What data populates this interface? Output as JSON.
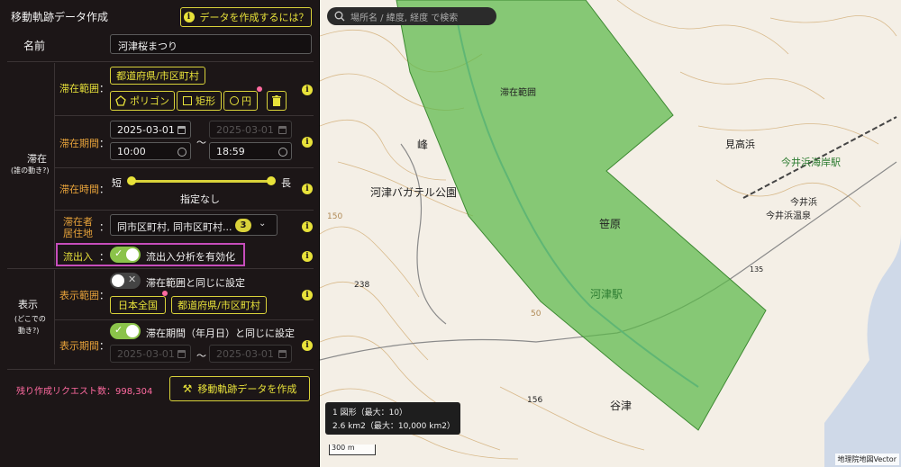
{
  "header": {
    "title": "移動軌跡データ作成",
    "help_button": "データを作成するには？"
  },
  "name_field": {
    "label": "名前",
    "value": "河津桜まつり"
  },
  "stay": {
    "section_label": "滞在",
    "section_sublabel": "(誰の動き?)",
    "range": {
      "label": "滞在範囲",
      "pref_button": "都道府県/市区町村",
      "polygon_button": "ポリゴン",
      "rect_button": "矩形",
      "circle_button": "円"
    },
    "period": {
      "label": "滞在期間",
      "start_date": "2025-03-01",
      "start_time": "10:00",
      "separator": "～",
      "end_date": "2025-03-01",
      "end_time": "18:59"
    },
    "time": {
      "label": "滞在時間",
      "short": "短",
      "long": "長",
      "value": "指定なし"
    },
    "residence": {
      "label_line1": "滞在者",
      "label_line2": "居住地",
      "value": "同市区町村, 同市区町村...",
      "count": "3"
    }
  },
  "inflow": {
    "label": "流出入",
    "colon": "：",
    "toggle_label": "流出入分析を有効化",
    "enabled": true
  },
  "display": {
    "section_label": "表示",
    "section_sublabel_1": "(どこでの",
    "section_sublabel_2": "動き?)",
    "range": {
      "label": "表示範囲",
      "same_label": "滞在範囲と同じに設定",
      "same_enabled": false,
      "japan_button": "日本全国",
      "pref_button": "都道府県/市区町村"
    },
    "period": {
      "label": "表示期間",
      "same_label": "滞在期間（年月日）と同じに設定",
      "same_enabled": true,
      "start_date": "2025-03-01",
      "separator": "～",
      "end_date": "2025-03-01"
    }
  },
  "footer": {
    "remaining": "残り作成リクエスト数：998,304",
    "create_button": "移動軌跡データを作成"
  },
  "map": {
    "search_placeholder": "場所名 / 緯度, 経度 で検索",
    "polygon_label": "滞在範囲",
    "info_line1": "1 図形（最大：10）",
    "info_line2": "2.6 km2（最大：10,000 km2）",
    "scale": "300 m",
    "attribution": "地理院地図Vector",
    "places": {
      "kawazu_bagatelle": "河津バガテル公園",
      "mine": "峰",
      "sasahara": "笹原",
      "kawazu_station": "河津駅",
      "yazu": "谷津",
      "mitakahama": "見高浜",
      "imaihama_station": "今井浜海岸駅",
      "imaihama": "今井浜",
      "imaihama_onsen": "今井浜温泉"
    },
    "elevations": {
      "e238": "238",
      "e156": "156",
      "e150": "150",
      "e50": "50",
      "e135": "135"
    }
  },
  "colors": {
    "accent_yellow": "#e8e23a",
    "accent_orange": "#e8a33a",
    "pink": "#ff6aa0",
    "polygon": "#5cb84a",
    "toggle_green": "#8bc34a"
  }
}
